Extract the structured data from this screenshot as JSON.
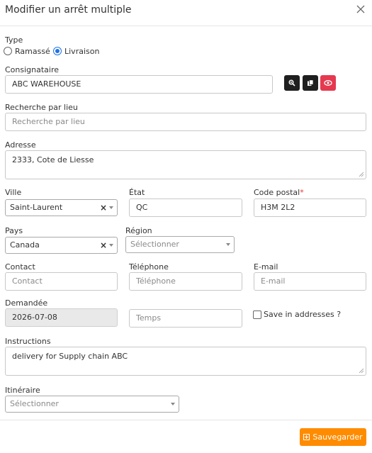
{
  "modal": {
    "title": "Modifier un arrêt multiple"
  },
  "type": {
    "label": "Type",
    "options": [
      {
        "label": "Ramassé",
        "selected": false
      },
      {
        "label": "Livraison",
        "selected": true
      }
    ]
  },
  "consignee": {
    "label": "Consignataire",
    "value": "ABC WAREHOUSE",
    "actions": [
      "search-icon",
      "copy-icon",
      "view-icon"
    ]
  },
  "location_search": {
    "label": "Recherche par lieu",
    "placeholder": "Recherche par lieu"
  },
  "address": {
    "label": "Adresse",
    "value": "2333, Cote de Liesse"
  },
  "city": {
    "label": "Ville",
    "value": "Saint-Laurent"
  },
  "state": {
    "label": "État",
    "value": "QC"
  },
  "postal_code": {
    "label": "Code postal",
    "required_mark": "*",
    "value": "H3M 2L2"
  },
  "country": {
    "label": "Pays",
    "value": "Canada"
  },
  "region": {
    "label": "Région",
    "placeholder": "Sélectionner"
  },
  "contact": {
    "label": "Contact",
    "placeholder": "Contact"
  },
  "phone": {
    "label": "Téléphone",
    "placeholder": "Téléphone"
  },
  "email": {
    "label": "E-mail",
    "placeholder": "E-mail"
  },
  "requested": {
    "label": "Demandée",
    "date": "2026-07-08",
    "time_placeholder": "Temps"
  },
  "save_address": {
    "label": "Save in addresses ?",
    "checked": false
  },
  "instructions": {
    "label": "Instructions",
    "value": "delivery for Supply chain ABC"
  },
  "itinerary": {
    "label": "Itinéraire",
    "placeholder": "Sélectionner"
  },
  "footer": {
    "save_label": "Sauvegarder"
  },
  "colors": {
    "accent": "#ff8c00",
    "danger": "#e53950",
    "primary": "#1e73e8"
  }
}
